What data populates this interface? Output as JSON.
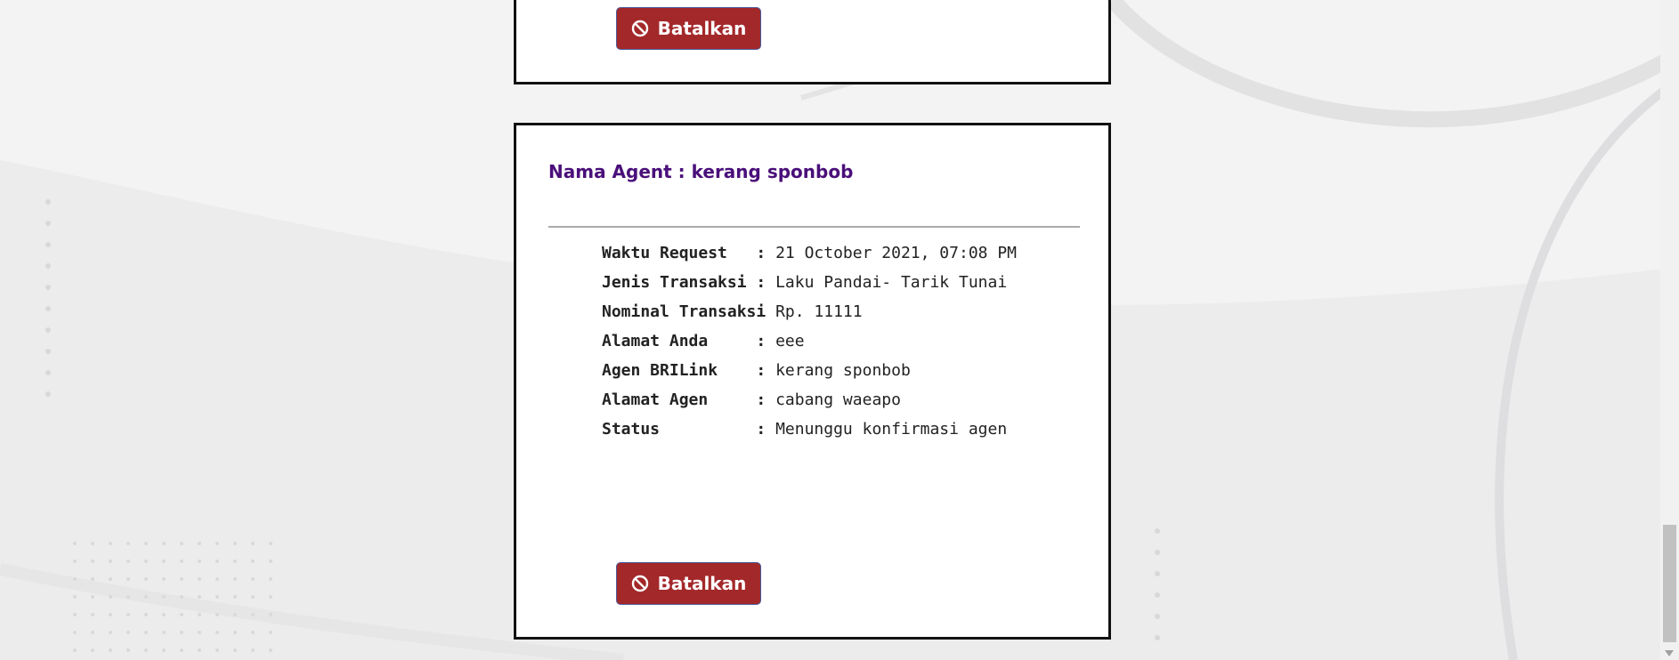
{
  "top_card": {
    "cancel_label": "Batalkan"
  },
  "request_card": {
    "agent_heading": "Nama Agent : kerang sponbob",
    "fields": [
      {
        "label": "Waktu Request   : ",
        "value": "21 October 2021, 07:08 PM"
      },
      {
        "label": "Jenis Transaksi : ",
        "value": "Laku Pandai- Tarik Tunai"
      },
      {
        "label": "Nominal Transaksi ",
        "value": "Rp. 11111"
      },
      {
        "label": "Alamat Anda     : ",
        "value": "eee"
      },
      {
        "label": "Agen BRILink    : ",
        "value": "kerang sponbob"
      },
      {
        "label": "Alamat Agen     : ",
        "value": "cabang waeapo"
      },
      {
        "label": "Status          : ",
        "value": "Menunggu konfirmasi agen"
      }
    ],
    "cancel_label": "Batalkan"
  },
  "icons": {
    "cancel": "ban-icon",
    "scroll_down": "scroll-down-arrow-icon"
  },
  "colors": {
    "cancel_button": "#a3282a",
    "agent_heading": "#4a0f7a",
    "card_border": "#111111"
  }
}
